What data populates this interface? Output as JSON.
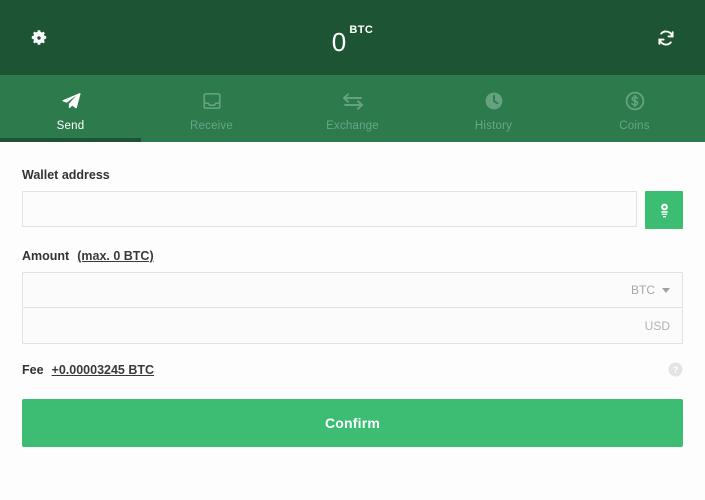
{
  "header": {
    "settings_icon": "gear-icon",
    "refresh_icon": "refresh-icon",
    "balance_amount": "0",
    "balance_unit": "BTC"
  },
  "tabs": [
    {
      "label": "Send",
      "icon": "paper-plane-icon",
      "active": true
    },
    {
      "label": "Receive",
      "icon": "inbox-tray-icon",
      "active": false
    },
    {
      "label": "Exchange",
      "icon": "exchange-arrows-icon",
      "active": false
    },
    {
      "label": "History",
      "icon": "clock-icon",
      "active": false
    },
    {
      "label": "Coins",
      "icon": "dollar-coin-icon",
      "active": false
    }
  ],
  "form": {
    "wallet_address_label": "Wallet address",
    "wallet_address_value": "",
    "wallet_address_placeholder": "",
    "scan_button_icon": "qr-scan-icon",
    "amount_label": "Amount",
    "amount_max_link": "(max. 0 BTC)",
    "amount_btc_value": "",
    "amount_btc_placeholder": "",
    "amount_btc_unit": "BTC",
    "amount_unit_caret": "chevron-down-icon",
    "amount_usd_value": "",
    "amount_usd_placeholder": "",
    "amount_usd_unit": "USD",
    "fee_label": "Fee",
    "fee_value": "+0.00003245 BTC",
    "help_icon": "question-mark-icon",
    "confirm_label": "Confirm"
  },
  "colors": {
    "header_green": "#1d5434",
    "tabbar_green": "#2d7a4d",
    "accent_green": "#3cbd73",
    "inactive_tab_text": "#68a684"
  }
}
